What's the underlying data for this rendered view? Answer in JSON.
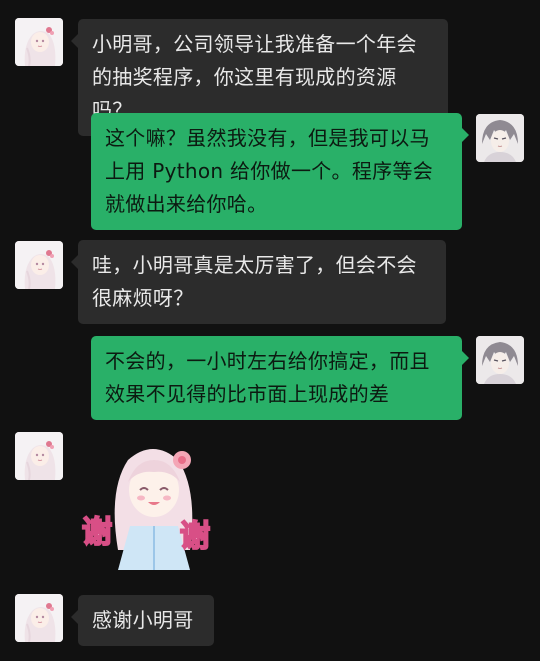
{
  "chat": {
    "messages": [
      {
        "side": "in",
        "text": "小明哥，公司领导让我准备一个年会的抽奖程序，你这里有现成的资源吗？"
      },
      {
        "side": "out",
        "text": "这个嘛？虽然我没有，但是我可以马上用 Python 给你做一个。程序等会就做出来给你哈。"
      },
      {
        "side": "in",
        "text": "哇，小明哥真是太厉害了，但会不会很麻烦呀？"
      },
      {
        "side": "out",
        "text": "不会的，一小时左右给你搞定，而且效果不见得的比市面上现成的差"
      },
      {
        "side": "in",
        "sticker": "thanks-sticker",
        "sticker_text": "谢谢"
      },
      {
        "side": "in",
        "text": "感谢小明哥"
      }
    ]
  },
  "colors": {
    "background": "#111111",
    "incoming_bubble": "#2c2c2c",
    "outgoing_bubble": "#29b068"
  },
  "icons": {
    "contact_avatar": "anime-girl-avatar",
    "self_avatar": "anime-boy-avatar"
  }
}
